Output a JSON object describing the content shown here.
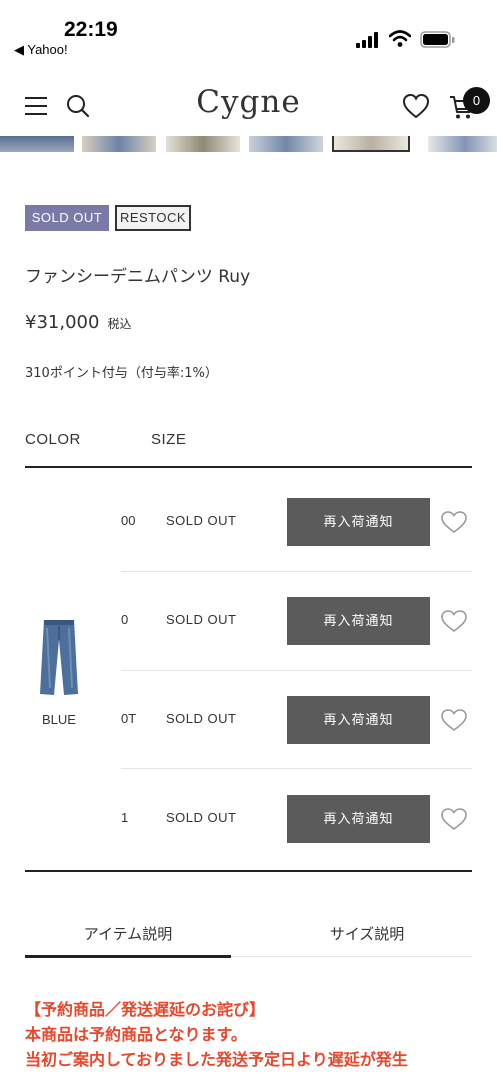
{
  "status_bar": {
    "time": "22:19",
    "back_app": "◀ Yahoo!"
  },
  "header": {
    "logo": "Cygne",
    "cart_count": "0"
  },
  "badges": {
    "sold_out": "SOLD OUT",
    "restock": "RESTOCK"
  },
  "product": {
    "title": "ファンシーデニムパンツ Ruy",
    "price": "¥31,000",
    "tax_label": "税込",
    "points": "310ポイント付与（付与率:1%）"
  },
  "table": {
    "color_header": "COLOR",
    "size_header": "SIZE",
    "variant": {
      "color_name": "BLUE"
    },
    "rows": [
      {
        "size": "00",
        "status": "SOLD OUT",
        "button": "再入荷通知"
      },
      {
        "size": "0",
        "status": "SOLD OUT",
        "button": "再入荷通知"
      },
      {
        "size": "0T",
        "status": "SOLD OUT",
        "button": "再入荷通知"
      },
      {
        "size": "1",
        "status": "SOLD OUT",
        "button": "再入荷通知"
      }
    ]
  },
  "tabs": [
    {
      "label": "アイテム説明"
    },
    {
      "label": "サイズ説明"
    }
  ],
  "notice": {
    "line1": "【予約商品／発送遅延のお詫び】",
    "line2": "本商品は予約商品となります。",
    "line3": "当初ご案内しておりました発送予定日より遅延が発生"
  },
  "colors": {
    "sold_out_badge": "#7a7aa7",
    "button": "#5b5b5b",
    "notice": "#e8472b"
  }
}
